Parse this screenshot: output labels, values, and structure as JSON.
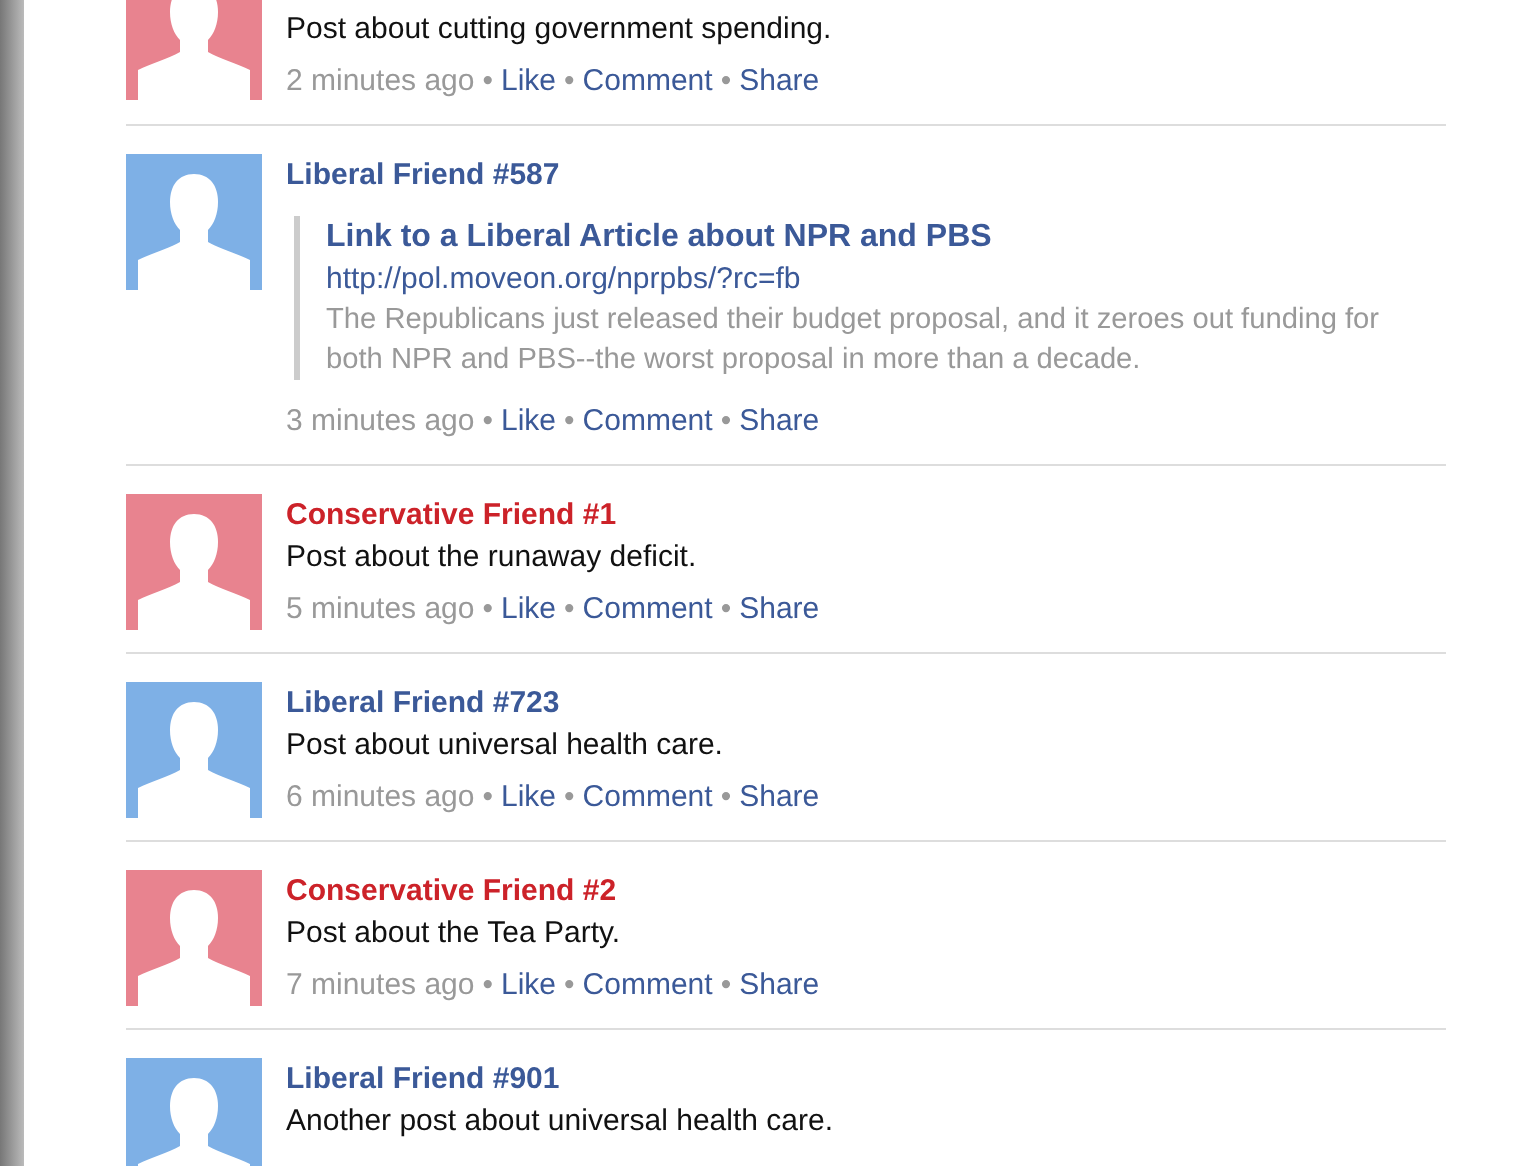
{
  "separator": "•",
  "posts": [
    {
      "kind": "conservative",
      "text": "Post about cutting government spending.",
      "time": "2 minutes ago",
      "actions": [
        "Like",
        "Comment",
        "Share"
      ]
    },
    {
      "kind": "liberal",
      "author": "Liberal Friend #587",
      "link": {
        "title": "Link to a Liberal Article about NPR and PBS",
        "url": "http://pol.moveon.org/nprpbs/?rc=fb",
        "description": "The Republicans just released their budget proposal, and it zeroes out funding for both NPR and PBS--the worst proposal in more than a decade."
      },
      "time": "3 minutes ago",
      "actions": [
        "Like",
        "Comment",
        "Share"
      ]
    },
    {
      "kind": "conservative",
      "author": "Conservative Friend #1",
      "text": "Post about the runaway deficit.",
      "time": "5 minutes ago",
      "actions": [
        "Like",
        "Comment",
        "Share"
      ]
    },
    {
      "kind": "liberal",
      "author": "Liberal Friend #723",
      "text": "Post about universal health care.",
      "time": "6 minutes ago",
      "actions": [
        "Like",
        "Comment",
        "Share"
      ]
    },
    {
      "kind": "conservative",
      "author": "Conservative Friend #2",
      "text": "Post about the Tea Party.",
      "time": "7 minutes ago",
      "actions": [
        "Like",
        "Comment",
        "Share"
      ]
    },
    {
      "kind": "liberal",
      "author": "Liberal Friend #901",
      "text": "Another post about universal health care."
    }
  ]
}
